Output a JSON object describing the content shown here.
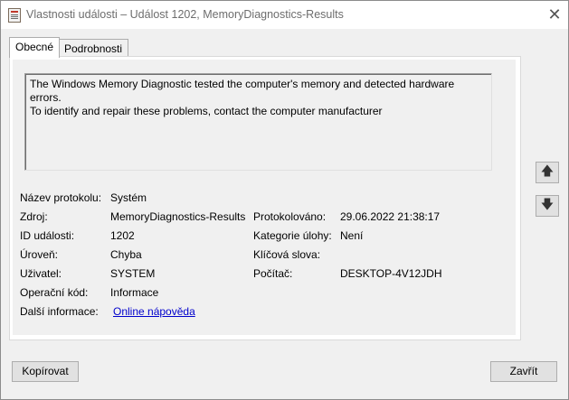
{
  "window": {
    "title": "Vlastnosti události – Událost 1202, MemoryDiagnostics-Results",
    "close_glyph": "✕"
  },
  "tabs": [
    {
      "label": "Obecné",
      "active": true
    },
    {
      "label": "Podrobnosti",
      "active": false
    }
  ],
  "description": {
    "line1": "The Windows Memory Diagnostic tested the computer's memory and detected hardware errors.",
    "line2": "To identify and repair these problems, contact the computer manufacturer"
  },
  "fields": {
    "log_name": {
      "label": "Název protokolu:",
      "value": "Systém"
    },
    "source": {
      "label": "Zdroj:",
      "value": "MemoryDiagnostics-Results"
    },
    "logged": {
      "label": "Protokolováno:",
      "value": "29.06.2022 21:38:17"
    },
    "event_id": {
      "label": "ID události:",
      "value": "1202"
    },
    "task_category": {
      "label": "Kategorie úlohy:",
      "value": "Není"
    },
    "level": {
      "label": "Úroveň:",
      "value": "Chyba"
    },
    "keywords": {
      "label": "Klíčová slova:",
      "value": ""
    },
    "user": {
      "label": "Uživatel:",
      "value": "SYSTEM"
    },
    "computer": {
      "label": "Počítač:",
      "value": "DESKTOP-4V12JDH"
    },
    "opcode": {
      "label": "Operační kód:",
      "value": "Informace"
    },
    "more_info": {
      "label": "Další informace:",
      "value": "Online nápověda"
    }
  },
  "nav": {
    "up_glyph": "🡅",
    "down_glyph": "🡇"
  },
  "buttons": {
    "copy": "Kopírovat",
    "close": "Zavřít"
  }
}
